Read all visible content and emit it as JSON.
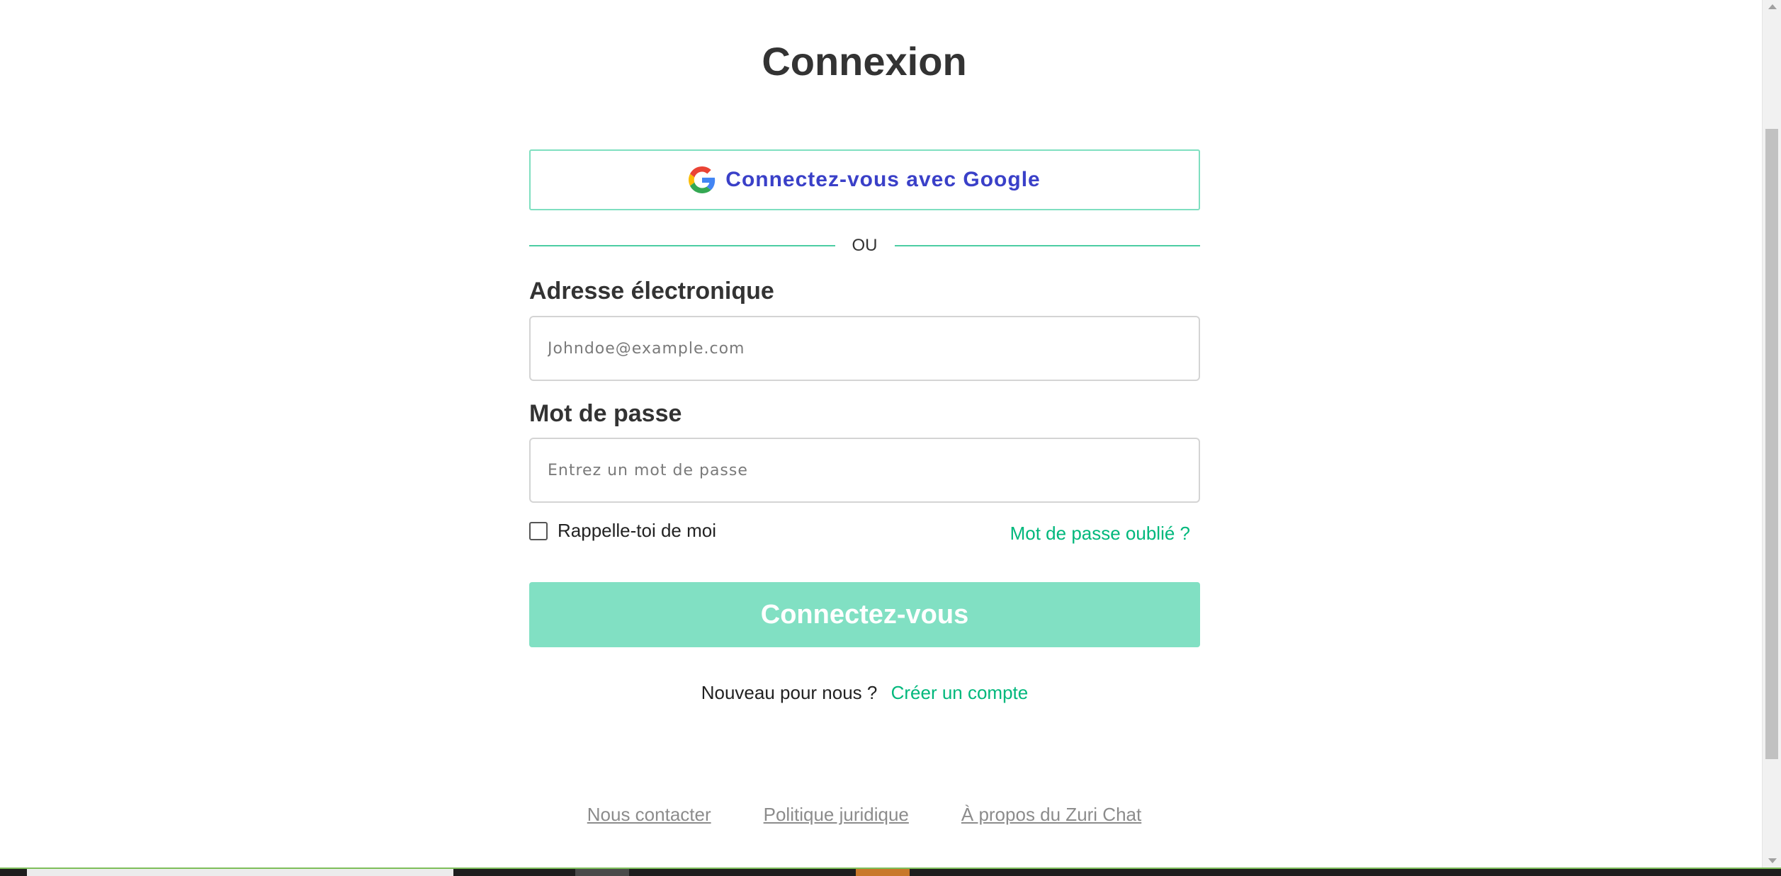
{
  "page": {
    "title": "Connexion"
  },
  "google_button": {
    "label": "Connectez-vous avec Google",
    "icon": "google-g-icon"
  },
  "divider": {
    "text": "OU"
  },
  "email": {
    "label": "Adresse électronique",
    "placeholder": "Johndoe@example.com",
    "value": ""
  },
  "password": {
    "label": "Mot de passe",
    "placeholder": "Entrez un mot de passe",
    "value": ""
  },
  "remember": {
    "label": "Rappelle-toi de moi",
    "checked": false
  },
  "forgot_link": "Mot de passe oublié ?",
  "submit_label": "Connectez-vous",
  "signup": {
    "prompt": "Nouveau pour nous ?",
    "link": "Créer un compte"
  },
  "footer": {
    "links": [
      "Nous contacter",
      "Politique juridique",
      "À propos du Zuri Chat"
    ]
  },
  "colors": {
    "accent": "#00b87c",
    "google_text": "#3a40c8",
    "submit_bg": "#81e0c3",
    "border_accent": "#7fdfc0"
  }
}
